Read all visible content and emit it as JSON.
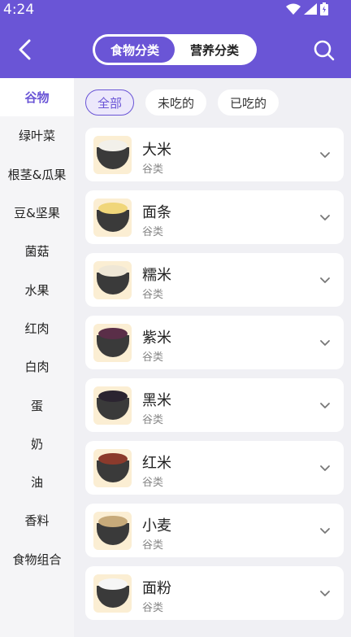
{
  "status": {
    "time": "4:24"
  },
  "header": {
    "tabs": [
      {
        "label": "食物分类",
        "active": true
      },
      {
        "label": "营养分类",
        "active": false
      }
    ],
    "accent": "#6a55d6"
  },
  "sidebar": {
    "items": [
      {
        "label": "谷物",
        "active": true
      },
      {
        "label": "绿叶菜"
      },
      {
        "label": "根茎&瓜果"
      },
      {
        "label": "豆&坚果"
      },
      {
        "label": "菌菇"
      },
      {
        "label": "水果"
      },
      {
        "label": "红肉"
      },
      {
        "label": "白肉"
      },
      {
        "label": "蛋"
      },
      {
        "label": "奶"
      },
      {
        "label": "油"
      },
      {
        "label": "香料"
      },
      {
        "label": "食物组合"
      }
    ]
  },
  "filters": [
    {
      "label": "全部",
      "active": true
    },
    {
      "label": "未吃的"
    },
    {
      "label": "已吃的"
    }
  ],
  "foods": [
    {
      "name": "大米",
      "category": "谷类",
      "color": "#f2f0ea"
    },
    {
      "name": "面条",
      "category": "谷类",
      "color": "#f0d67a"
    },
    {
      "name": "糯米",
      "category": "谷类",
      "color": "#efe7d6"
    },
    {
      "name": "紫米",
      "category": "谷类",
      "color": "#5a2e48"
    },
    {
      "name": "黑米",
      "category": "谷类",
      "color": "#2b2430"
    },
    {
      "name": "红米",
      "category": "谷类",
      "color": "#8b3a2c"
    },
    {
      "name": "小麦",
      "category": "谷类",
      "color": "#c7aa7a"
    },
    {
      "name": "面粉",
      "category": "谷类",
      "color": "#f6f6f6"
    }
  ]
}
